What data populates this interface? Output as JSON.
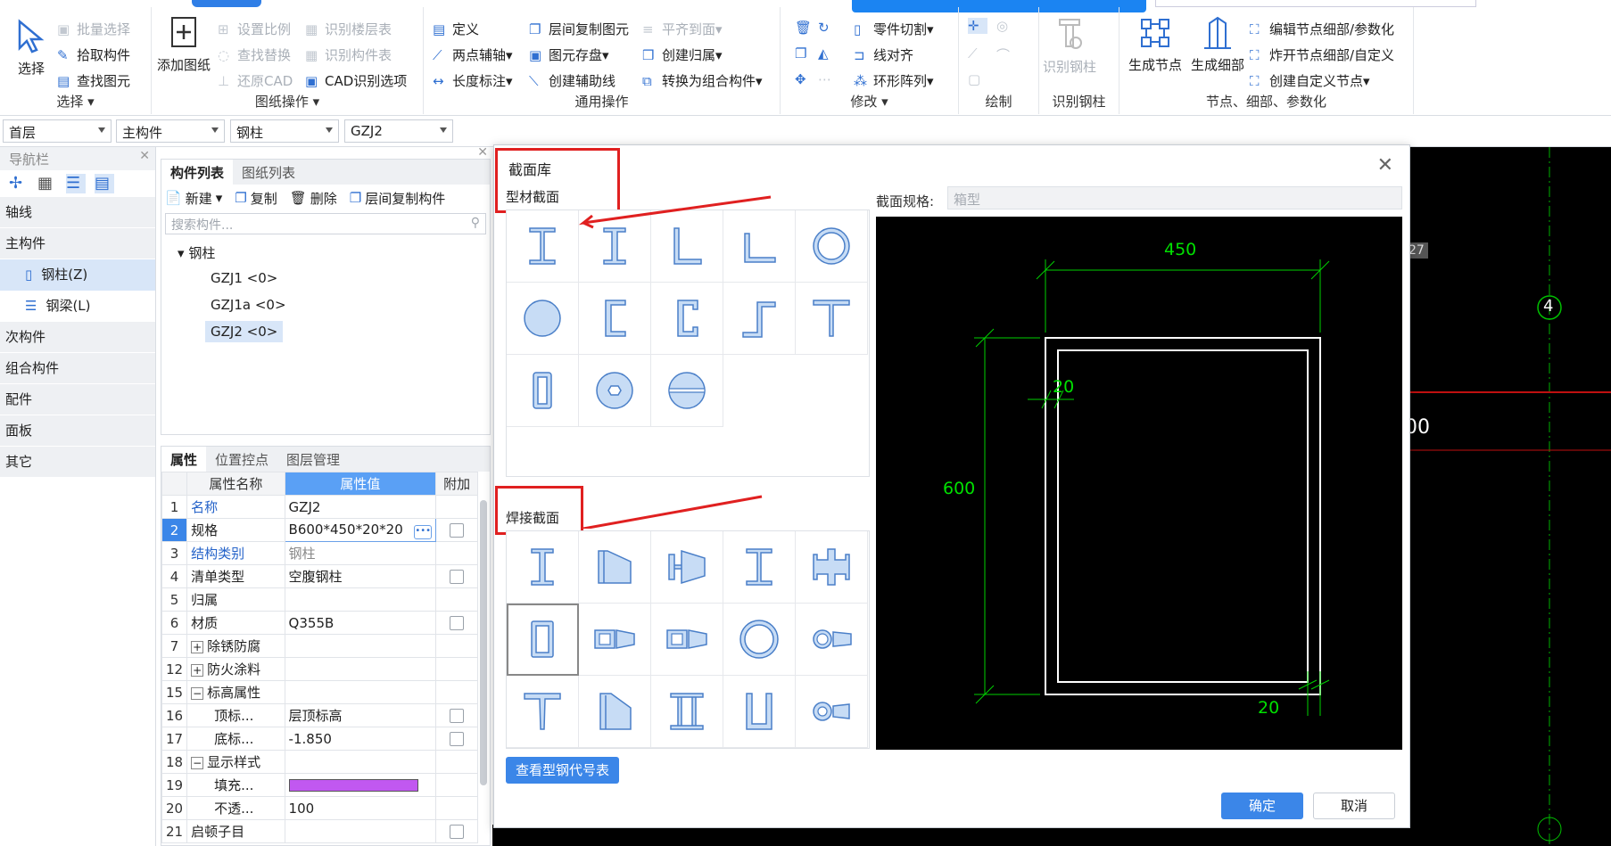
{
  "ribbon": {
    "select_group": {
      "label": "选择",
      "select": "选择",
      "batch_select": "批量选择",
      "pick_component": "拾取构件",
      "find_element": "查找图元"
    },
    "drawing_group": {
      "label": "图纸操作",
      "add_drawing": "添加图纸",
      "set_scale": "设置比例",
      "find_replace": "查找替换",
      "restore_cad": "还原CAD",
      "identify_floor_table": "识别楼层表",
      "identify_component_table": "识别构件表",
      "cad_identify_options": "CAD识别选项"
    },
    "general_group": {
      "label": "通用操作",
      "define": "定义",
      "two_point_axis": "两点辅轴",
      "length_dim": "长度标注",
      "copy_floor_element": "层间复制图元",
      "element_save": "图元存盘",
      "create_aux_line": "创建辅助线",
      "flush": "平齐到面",
      "create_group": "创建归属",
      "convert_combo": "转换为组合构件"
    },
    "modify_group": {
      "label": "修改",
      "part_cut": "零件切割",
      "line_align": "线对齐",
      "ring_array": "环形阵列"
    },
    "draw_group": {
      "label": "绘制"
    },
    "identify_group": {
      "label": "识别钢柱",
      "identify_steel_column": "识别钢柱"
    },
    "node_group": {
      "label": "节点、细部、参数化",
      "generate_node": "生成节点",
      "generate_detail": "生成细部",
      "edit_node": "编辑节点细部/参数化",
      "explode_node": "炸开节点细部/自定义",
      "create_custom_node": "创建自定义节点"
    }
  },
  "toolbar": {
    "floor": "首层",
    "category": "主构件",
    "type": "钢柱",
    "instance": "GZJ2"
  },
  "nav": {
    "title": "导航栏",
    "categories": [
      "轴线",
      "主构件"
    ],
    "sub_items": [
      {
        "label": "钢柱(Z)"
      },
      {
        "label": "钢梁(L)"
      }
    ],
    "more": [
      "次构件",
      "组合构件",
      "配件",
      "面板",
      "其它"
    ]
  },
  "component_panel": {
    "tabs": [
      "构件列表",
      "图纸列表"
    ],
    "tools": {
      "new": "新建",
      "copy": "复制",
      "delete": "删除",
      "copy_floor": "层间复制构件"
    },
    "search_placeholder": "搜索构件...",
    "tree_root": "钢柱",
    "items": [
      "GZJ1 <0>",
      "GZJ1a <0>",
      "GZJ2 <0>"
    ]
  },
  "properties": {
    "tabs": [
      "属性",
      "位置控点",
      "图层管理"
    ],
    "headers": {
      "name": "属性名称",
      "value": "属性值",
      "extra": "附加"
    },
    "rows": [
      {
        "n": "1",
        "name": "名称",
        "value": "GZJ2"
      },
      {
        "n": "2",
        "name": "规格",
        "value": "B600*450*20*20"
      },
      {
        "n": "3",
        "name": "结构类别",
        "value": "钢柱"
      },
      {
        "n": "4",
        "name": "清单类型",
        "value": "空腹钢柱"
      },
      {
        "n": "5",
        "name": "归属",
        "value": ""
      },
      {
        "n": "6",
        "name": "材质",
        "value": "Q355B"
      },
      {
        "n": "7",
        "name": "除锈防腐",
        "value": ""
      },
      {
        "n": "12",
        "name": "防火涂料",
        "value": ""
      },
      {
        "n": "15",
        "name": "标高属性",
        "value": ""
      },
      {
        "n": "16",
        "name": "顶标...",
        "value": "层顶标高"
      },
      {
        "n": "17",
        "name": "底标...",
        "value": "-1.850"
      },
      {
        "n": "18",
        "name": "显示样式",
        "value": ""
      },
      {
        "n": "19",
        "name": "填充...",
        "value": ""
      },
      {
        "n": "20",
        "name": "不透...",
        "value": "100"
      },
      {
        "n": "21",
        "name": "启顿子目",
        "value": ""
      }
    ],
    "fill_color": "#c158f0"
  },
  "dialog": {
    "title": "截面库",
    "section1": "型材截面",
    "section2": "焊接截面",
    "spec_label": "截面规格:",
    "spec_value": "箱型",
    "preview": {
      "width_dim": "450",
      "height_dim": "600",
      "flange": "20",
      "web": "20"
    },
    "btn_table": "查看型钢代号表",
    "btn_ok": "确定",
    "btn_cancel": "取消"
  },
  "canvas": {
    "axis_label": "4",
    "coord_partial": "27",
    "text_partial": "00"
  },
  "colors": {
    "accent": "#3b86e8",
    "highlight_red": "#e02020",
    "dim_green": "#00d000"
  }
}
